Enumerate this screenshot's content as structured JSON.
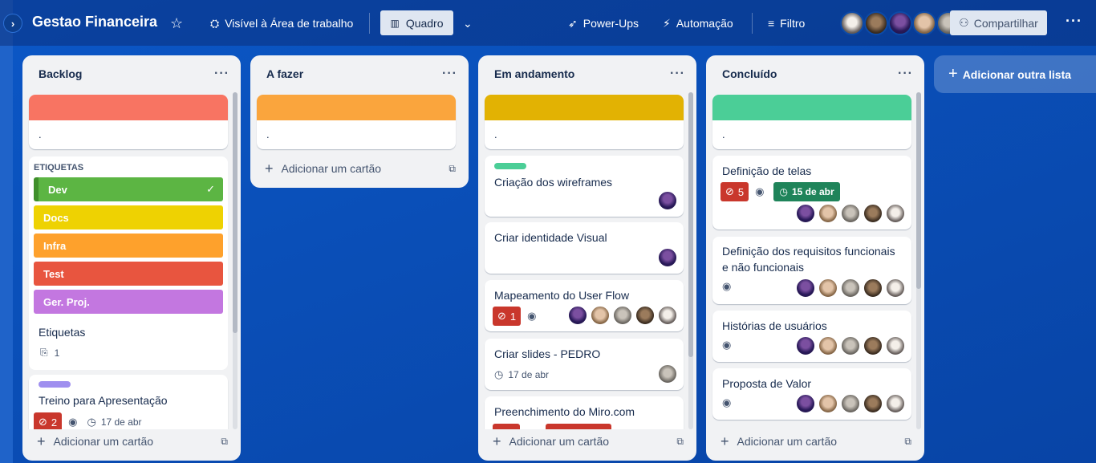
{
  "header": {
    "title": "Gestao Financeira",
    "visibility": "Visível à Área de trabalho",
    "view": "Quadro",
    "powerups": "Power-Ups",
    "automation": "Automação",
    "filter": "Filtro",
    "share": "Compartilhar"
  },
  "common": {
    "add_card": "Adicionar um cartão",
    "add_list": "Adicionar outra lista"
  },
  "lists": [
    {
      "title": "Backlog",
      "cover_text": ".",
      "labels_title": "ETIQUETAS",
      "labels": [
        "Dev",
        "Docs",
        "Infra",
        "Test",
        "Ger. Proj."
      ],
      "etiquetas_card": {
        "title": "Etiquetas",
        "attachments": "1"
      },
      "treino_card": {
        "title": "Treino para Apresentação",
        "comments": "2",
        "date": "17 de abr"
      }
    },
    {
      "title": "A fazer",
      "cover_text": "."
    },
    {
      "title": "Em andamento",
      "cover_text": ".",
      "cards": [
        {
          "title": "Criação dos wireframes"
        },
        {
          "title": "Criar identidade Visual"
        },
        {
          "title": "Mapeamento do User Flow",
          "comments": "1"
        },
        {
          "title": "Criar slides - PEDRO",
          "date": "17 de abr"
        },
        {
          "title": "Preenchimento do Miro.com"
        }
      ]
    },
    {
      "title": "Concluído",
      "cover_text": ".",
      "cards": [
        {
          "title": "Definição de telas",
          "comments": "5",
          "date": "15 de abr"
        },
        {
          "title": "Definição dos requisitos funcionais e não funcionais"
        },
        {
          "title": "Histórias de usuários"
        },
        {
          "title": "Proposta de Valor"
        }
      ]
    }
  ],
  "colors": {
    "cover_backlog": "#f87462",
    "cover_afazer": "#faa53d",
    "cover_andamento": "#e2b203",
    "cover_concluido": "#4bce97",
    "label_dev": "#5cb543",
    "label_docs": "#eed202",
    "label_infra": "#fea12c",
    "label_test": "#e8553f",
    "label_gerproj": "#c377e0"
  },
  "icons": [
    "chevron-right-icon",
    "star-icon",
    "workspace-icon",
    "board-icon",
    "chevron-down-icon",
    "rocket-icon",
    "bolt-icon",
    "filter-icon",
    "add-user-icon",
    "more-icon",
    "eye-icon",
    "clock-icon",
    "comment-icon",
    "paperclip-icon",
    "template-icon",
    "check-icon",
    "plus-icon"
  ]
}
